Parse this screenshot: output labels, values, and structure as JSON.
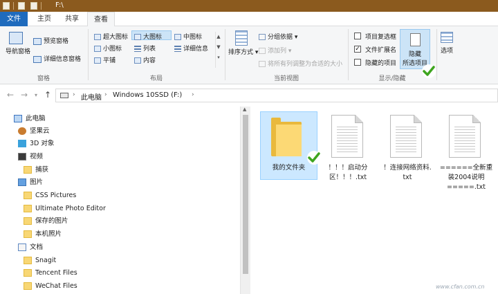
{
  "window": {
    "title": "F:\\"
  },
  "tabs": [
    "文件",
    "主页",
    "共享",
    "查看"
  ],
  "ribbon": {
    "pane_group": {
      "label": "窗格",
      "navigation_pane": "导航窗格",
      "preview_pane": "预览窗格",
      "details_pane": "详细信息窗格"
    },
    "layout_group": {
      "label": "布局",
      "extra_large_icons": "超大图标",
      "large_icons": "大图标",
      "medium_icons": "中图标",
      "small_icons": "小图标",
      "list": "列表",
      "details": "详细信息",
      "tiles": "平铺",
      "content": "内容"
    },
    "current_view_group": {
      "label": "当前视图",
      "sort_by": "排序方式",
      "group_by": "分组依据",
      "add_columns": "添加列",
      "size_all_columns": "将所有列调整为合适的大小"
    },
    "show_hide_group": {
      "label": "显示/隐藏",
      "item_checkboxes": {
        "label": "项目复选框",
        "checked": false
      },
      "file_extensions": {
        "label": "文件扩展名",
        "checked": true
      },
      "hidden_items": {
        "label": "隐藏的项目",
        "checked": false
      },
      "hide_selected_line1": "隐藏",
      "hide_selected_line2": "所选项目",
      "options": "选项"
    }
  },
  "address": {
    "breadcrumbs": [
      "此电脑",
      "Windows 10SSD (F:)"
    ]
  },
  "nav_pane": {
    "items": [
      {
        "label": "此电脑",
        "icon": "pc-icon"
      },
      {
        "label": "坚果云",
        "icon": "nutstore-icon"
      },
      {
        "label": "3D 对象",
        "icon": "cube-icon"
      },
      {
        "label": "视频",
        "icon": "video-icon"
      },
      {
        "label": "捕获",
        "icon": "folder-icon"
      },
      {
        "label": "图片",
        "icon": "pictures-icon"
      },
      {
        "label": "CSS Pictures",
        "icon": "folder-icon"
      },
      {
        "label": "Ultimate Photo Editor",
        "icon": "folder-icon"
      },
      {
        "label": "保存的图片",
        "icon": "folder-icon"
      },
      {
        "label": "本机照片",
        "icon": "folder-icon"
      },
      {
        "label": "文档",
        "icon": "documents-icon"
      },
      {
        "label": "Snagit",
        "icon": "folder-icon"
      },
      {
        "label": "Tencent Files",
        "icon": "folder-icon"
      },
      {
        "label": "WeChat Files",
        "icon": "folder-icon"
      }
    ]
  },
  "files": [
    {
      "line1": "我的文件夹",
      "line2": "",
      "type": "folder",
      "selected": true
    },
    {
      "line1": "！！！启动分",
      "line2": "区！！！.txt",
      "type": "txt"
    },
    {
      "line1": "！连接网络资料.",
      "line2": "txt",
      "type": "txt"
    },
    {
      "line1": "======全新重",
      "line2": "装2004说明",
      "line3": "=====.txt",
      "type": "txt"
    }
  ],
  "watermark": "www.cfan.com.cn",
  "colors": {
    "file_tab": "#1f6bbd",
    "titlebar": "#8b5a1e",
    "selection": "#cce8ff",
    "check_green": "#3ea51f"
  }
}
